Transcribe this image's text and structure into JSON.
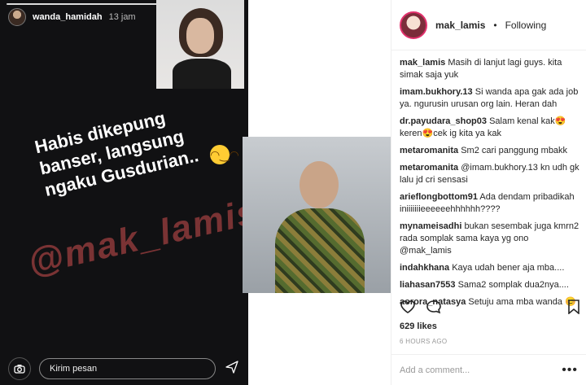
{
  "story": {
    "username": "wanda_hamidah",
    "time": "13 jam",
    "text": "Habis dikepung\nbanser, langsung\nngaku Gusdurian..",
    "watermark": "@mak_lamis",
    "message_placeholder": "Kirim pesan",
    "emoji": "😏",
    "camera_icon": "camera-icon",
    "send_icon": "send-icon"
  },
  "post": {
    "username": "mak_lamis",
    "separator": "•",
    "follow_status": "Following",
    "comments": [
      {
        "user": "mak_lamis",
        "text": "Masih di lanjut lagi guys. kita simak saja yuk"
      },
      {
        "user": "imam.bukhory.13",
        "text": "Si wanda apa gak ada job ya. ngurusin urusan org lain. Heran dah"
      },
      {
        "user": "dr.payudara_shop03",
        "text": "Salam kenal kak😍 keren😍cek ig kita ya kak"
      },
      {
        "user": "metaromanita",
        "text": "Sm2 cari panggung mbakk"
      },
      {
        "user": "metaromanita",
        "text": "@imam.bukhory.13 kn udh gk lalu jd cri sensasi"
      },
      {
        "user": "arieflongbottom91",
        "text": "Ada dendam pribadikah iniiiiiiieeeeeehhhhhh????"
      },
      {
        "user": "mynameisadhi",
        "text": "bukan sesembak juga kmrn2 rada somplak sama kaya yg ono @mak_lamis"
      },
      {
        "user": "indahkhana",
        "text": "Kaya udah bener aja mba...."
      },
      {
        "user": "liahasan7553",
        "text": "Sama2 somplak dua2nya...."
      },
      {
        "user": "aorora_natasya",
        "text": "Setuju ama mba wanda 😊"
      }
    ],
    "likes": "629 likes",
    "time": "6 HOURS AGO",
    "add_comment_placeholder": "Add a comment...",
    "more": "•••"
  }
}
